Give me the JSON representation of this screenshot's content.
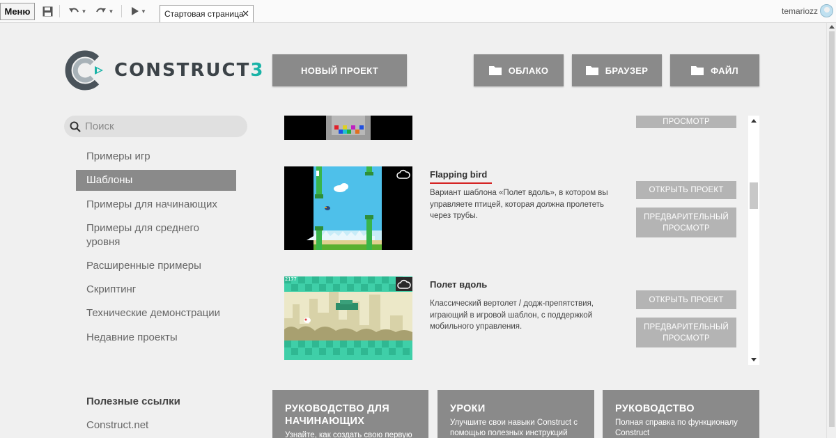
{
  "toolbar": {
    "menu_label": "Меню",
    "tab_label": "Стартовая страница",
    "username": "temariozz"
  },
  "header": {
    "logo_text": "CONSTRUCT",
    "logo_number": "3",
    "new_project_label": "НОВЫЙ ПРОЕКТ",
    "cloud_label": "ОБЛАКО",
    "browser_label": "БРАУЗЕР",
    "file_label": "ФАЙЛ"
  },
  "sidebar": {
    "search_placeholder": "Поиск",
    "items": [
      {
        "label": "Примеры игр",
        "active": false
      },
      {
        "label": "Шаблоны",
        "active": true
      },
      {
        "label": "Примеры для начинающих",
        "active": false
      },
      {
        "label": "Примеры для среднего уровня",
        "active": false
      },
      {
        "label": "Расширенные примеры",
        "active": false
      },
      {
        "label": "Скриптинг",
        "active": false
      },
      {
        "label": "Технические демонстрации",
        "active": false
      },
      {
        "label": "Недавние проекты",
        "active": false
      }
    ],
    "useful_links_heading": "Полезные ссылки",
    "links": [
      "Construct.net"
    ]
  },
  "templates": {
    "partial_button_label": "ПРОСМОТР",
    "items": [
      {
        "title": "Flapping bird",
        "description": "Вариант шаблона «Полет вдоль», в котором вы управляете птицей, которая должна пролететь через трубы.",
        "open_label": "ОТКРЫТЬ ПРОЕКТ",
        "preview_label": "ПРЕДВАРИТЕЛЬНЫЙ ПРОСМОТР",
        "cloud_badge": true
      },
      {
        "title": "Полет вдоль",
        "description": "Классический вертолет / додж-препятствия, играющий в игровой шаблон, с поддержкой мобильного управления.",
        "open_label": "ОТКРЫТЬ ПРОЕКТ",
        "preview_label": "ПРЕДВАРИТЕЛЬНЫЙ ПРОСМОТР",
        "cloud_badge": true,
        "score_text": "2177"
      }
    ]
  },
  "cards": [
    {
      "title": "РУКОВОДСТВО ДЛЯ НАЧИНАЮЩИХ",
      "description": "Узнайте, как создать свою первую"
    },
    {
      "title": "УРОКИ",
      "description": "Улучшите свои навыки Construct с помощью полезных инструкций"
    },
    {
      "title": "РУКОВОДСТВО",
      "description": "Полная справка по функционалу Construct"
    }
  ],
  "colors": {
    "accent": "#19b3a7",
    "button_dark": "#8a8a8a",
    "button_light": "#b4b4b4",
    "underline": "#d42020"
  }
}
